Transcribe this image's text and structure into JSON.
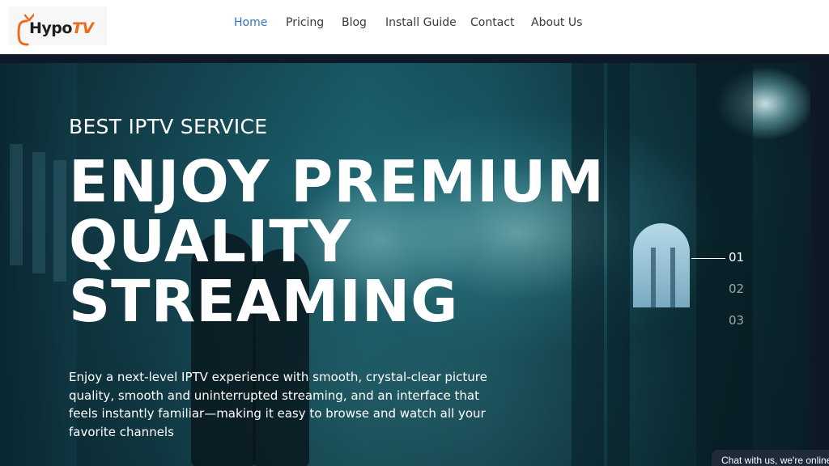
{
  "brand": {
    "logo_part1": "Hypo",
    "logo_part2": "TV",
    "accent": "#ef6a1f"
  },
  "nav": {
    "active_color": "#2f74c0",
    "items": [
      {
        "label": "Home",
        "active": true
      },
      {
        "label": "Pricing",
        "active": false
      },
      {
        "label": "Blog",
        "active": false
      },
      {
        "label": "Install Guide",
        "active": false
      },
      {
        "label": "Contact",
        "active": false
      },
      {
        "label": "About Us",
        "active": false
      }
    ]
  },
  "hero": {
    "eyebrow": "BEST IPTV SERVICE",
    "headline_lines": [
      "ENJOY PREMIUM",
      "QUALITY",
      "STREAMING"
    ],
    "description": "Enjoy a next-level IPTV experience with smooth, crystal-clear picture quality, smooth and uninterrupted streaming, and an interface that feels instantly familiar—making it easy to browse and watch all your favorite channels",
    "slides": [
      "01",
      "02",
      "03"
    ],
    "active_slide": "01"
  },
  "chat": {
    "label": "Chat with us, we're online"
  }
}
